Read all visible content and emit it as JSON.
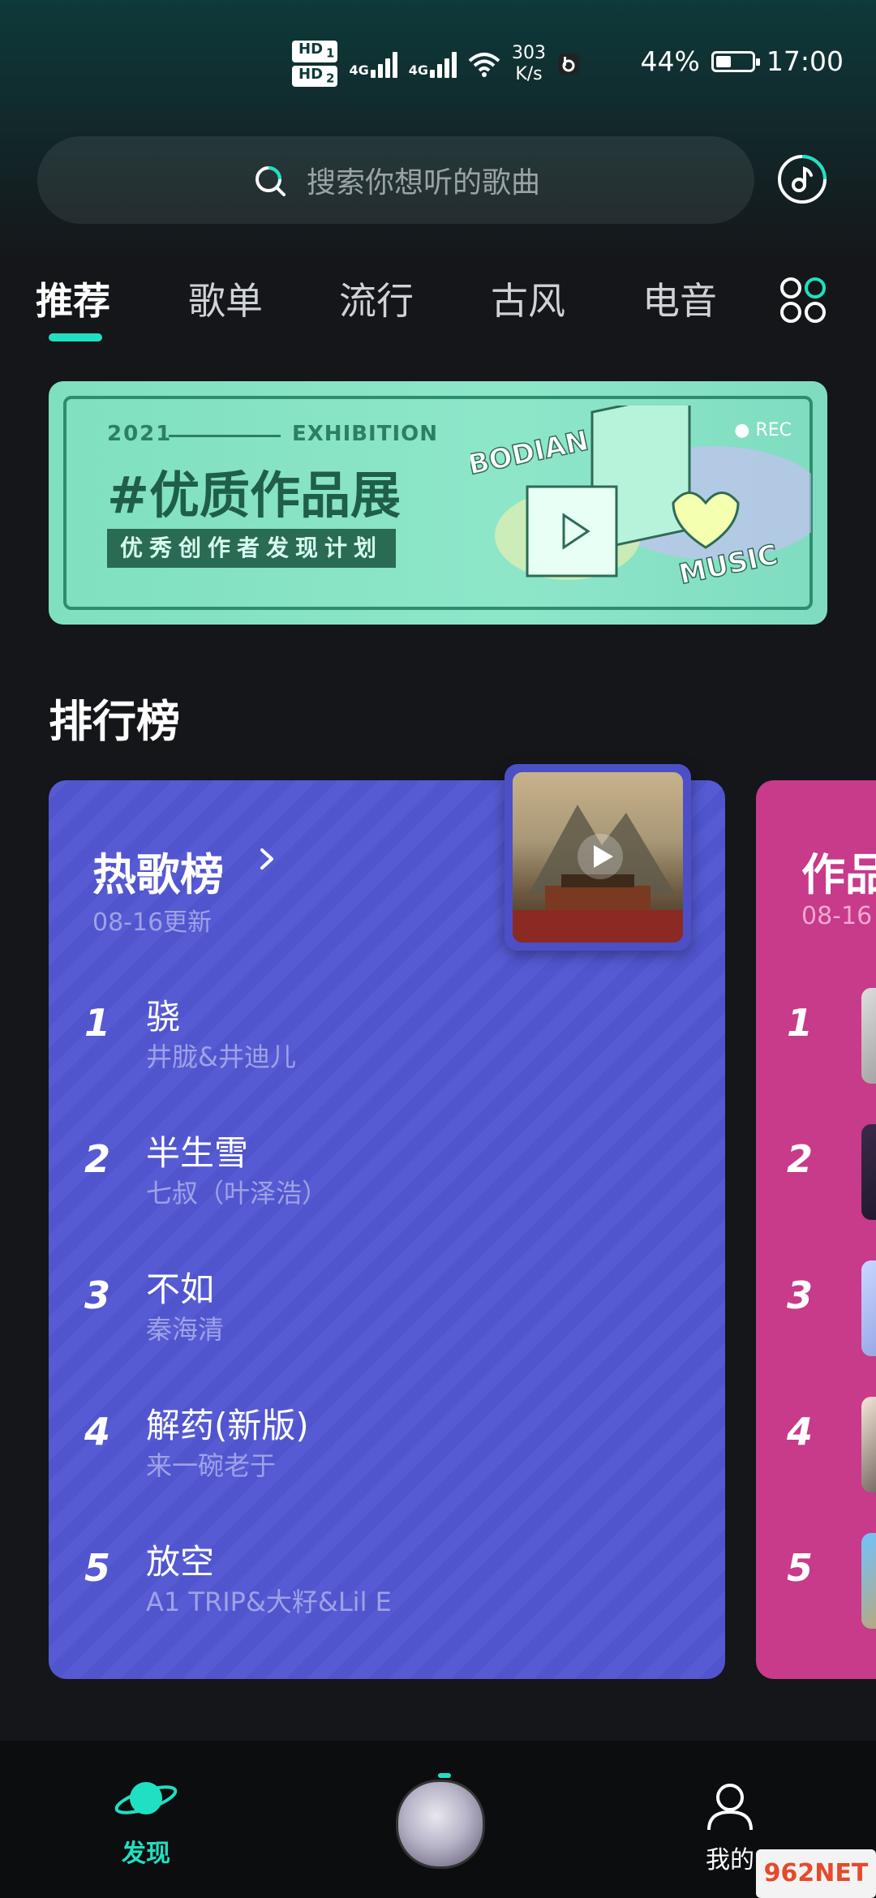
{
  "status_bar": {
    "hd1": "HD",
    "hd1_sub": "1",
    "hd2": "HD",
    "hd2_sub": "2",
    "net1": "4G",
    "net2": "4G",
    "speed_value": "303",
    "speed_unit": "K/s",
    "battery_text": "44%",
    "battery_level": 0.44,
    "time": "17:00"
  },
  "search": {
    "placeholder": "搜索你想听的歌曲"
  },
  "tabs": [
    {
      "label": "推荐",
      "active": true
    },
    {
      "label": "歌单",
      "active": false
    },
    {
      "label": "流行",
      "active": false
    },
    {
      "label": "古风",
      "active": false
    },
    {
      "label": "电音",
      "active": false
    }
  ],
  "banner": {
    "year": "2021",
    "exhibition": "EXHIBITION",
    "title": "#优质作品展",
    "subtitle": "优秀创作者发现计划",
    "rec": "● REC",
    "brand1": "BODIAN",
    "brand2": "MUSIC"
  },
  "ranking": {
    "section_title": "排行榜",
    "hot_chart": {
      "title": "热歌榜",
      "updated": "08-16更新",
      "songs": [
        {
          "rank": "1",
          "name": "骁",
          "artist": "井胧&井迪儿"
        },
        {
          "rank": "2",
          "name": "半生雪",
          "artist": "七叔（叶泽浩）"
        },
        {
          "rank": "3",
          "name": "不如",
          "artist": "秦海清"
        },
        {
          "rank": "4",
          "name": "解药(新版)",
          "artist": "来一碗老于"
        },
        {
          "rank": "5",
          "name": "放空",
          "artist": "A1 TRIP&大籽&Lil E"
        }
      ]
    },
    "second_chart": {
      "title": "作品",
      "updated": "08-16",
      "ranks": [
        "1",
        "2",
        "3",
        "4",
        "5"
      ]
    }
  },
  "bottom_nav": {
    "discover": "发现",
    "me": "我的"
  },
  "watermark": "962NET",
  "colors": {
    "accent": "#1fe0c2",
    "hot_chart_bg": "#5257d2",
    "second_chart_bg": "#c83a8a",
    "banner_bg": "#8ee6c9"
  }
}
